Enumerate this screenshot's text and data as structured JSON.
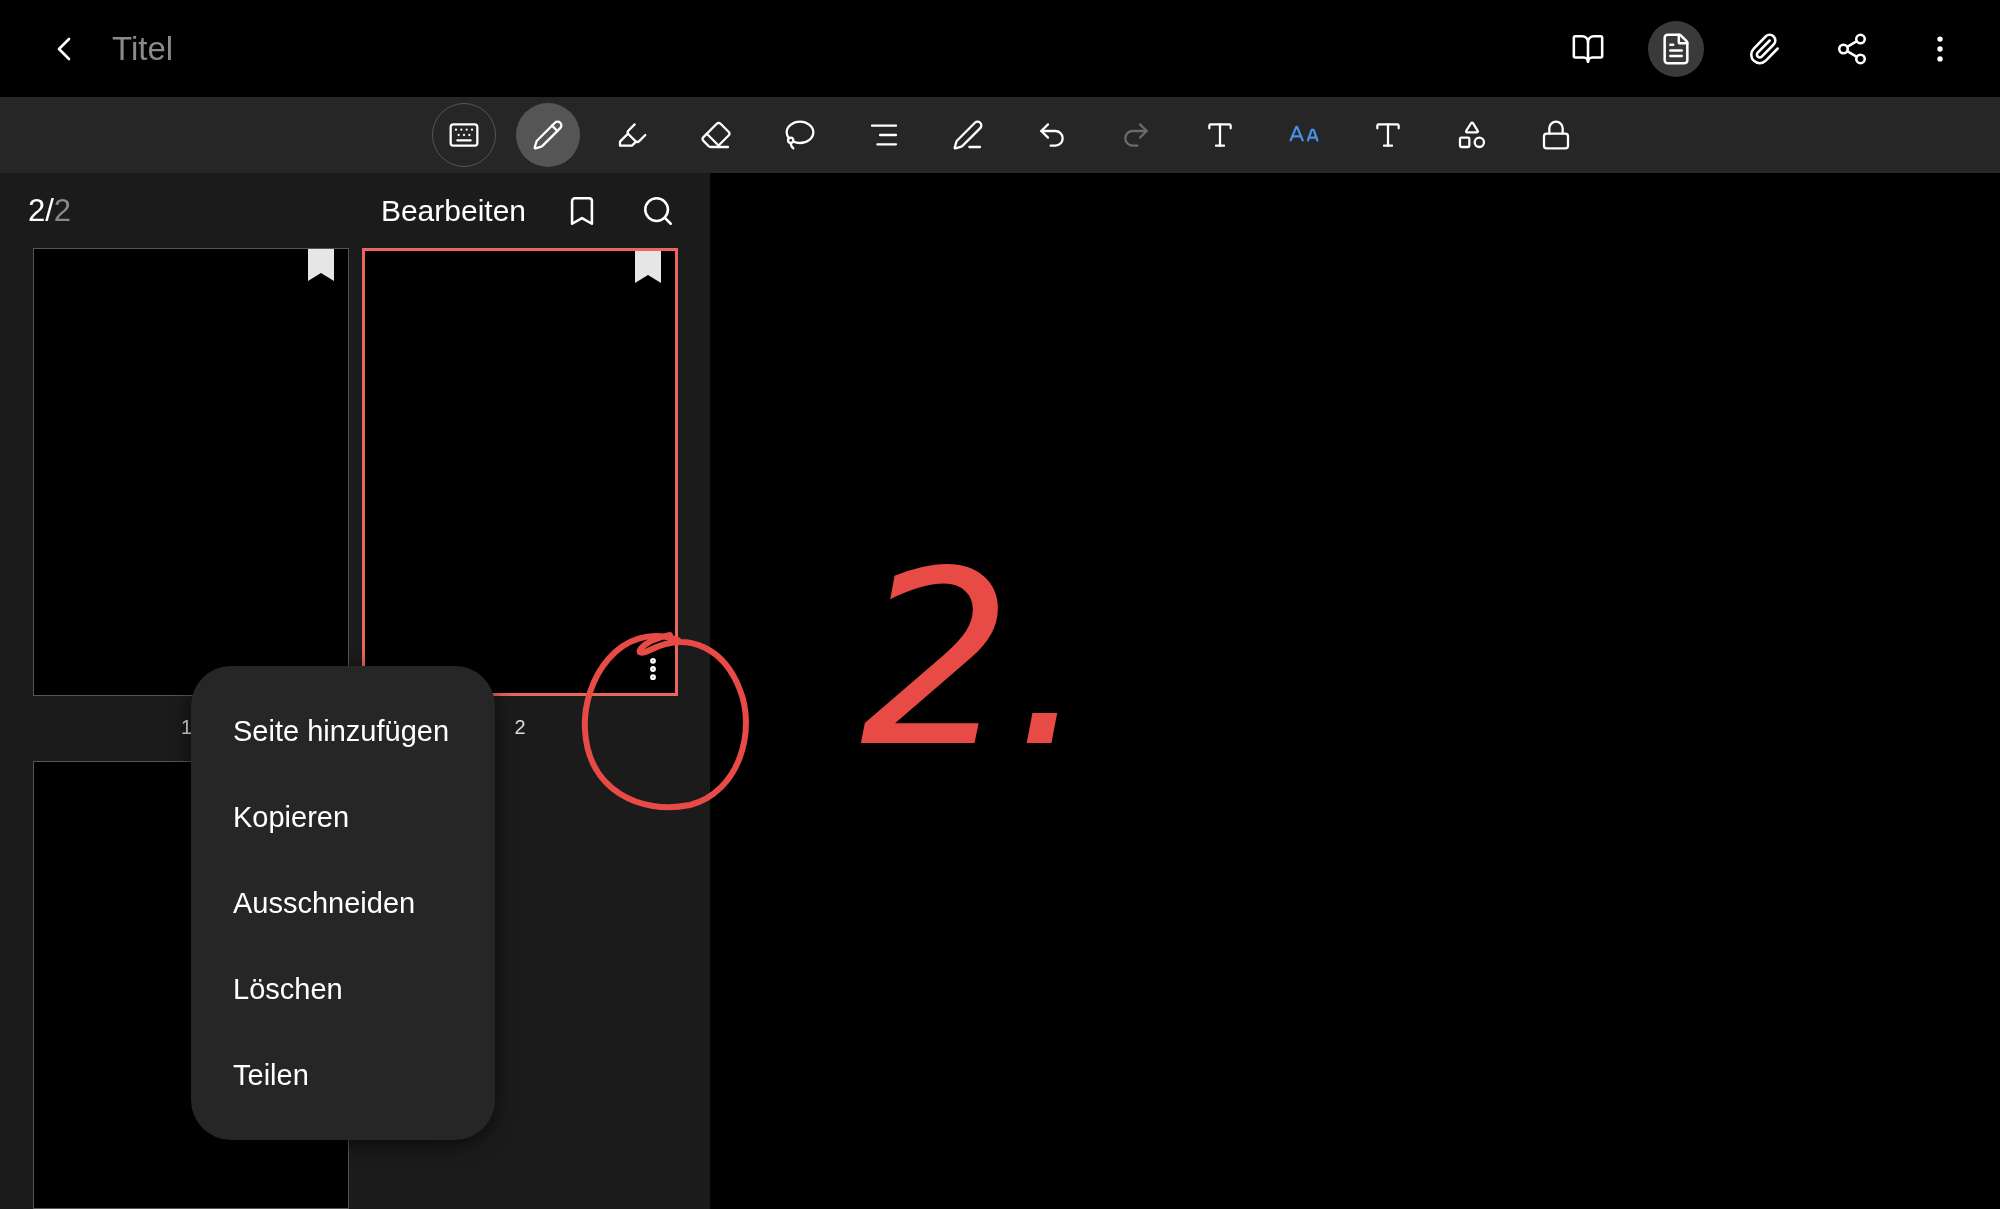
{
  "header": {
    "title": "Titel",
    "actions": [
      {
        "kind": "book",
        "selected": false
      },
      {
        "kind": "page-view",
        "selected": true
      },
      {
        "kind": "attach",
        "selected": false
      },
      {
        "kind": "share",
        "selected": false
      },
      {
        "kind": "more",
        "selected": false
      }
    ]
  },
  "toolbar": {
    "tools": [
      {
        "kind": "keyboard",
        "selected": false,
        "disabled": false
      },
      {
        "kind": "pen",
        "selected": true,
        "disabled": false
      },
      {
        "kind": "highlighter",
        "selected": false,
        "disabled": false
      },
      {
        "kind": "eraser",
        "selected": false,
        "disabled": false
      },
      {
        "kind": "lasso",
        "selected": false,
        "disabled": false
      },
      {
        "kind": "align",
        "selected": false,
        "disabled": false
      },
      {
        "kind": "pen-text",
        "selected": false,
        "disabled": false
      },
      {
        "kind": "undo",
        "selected": false,
        "disabled": false
      },
      {
        "kind": "redo",
        "selected": false,
        "disabled": true
      },
      {
        "kind": "handwriting",
        "selected": false,
        "disabled": false
      },
      {
        "kind": "text-style",
        "selected": false,
        "disabled": false
      },
      {
        "kind": "text-box",
        "selected": false,
        "disabled": false
      },
      {
        "kind": "shapes",
        "selected": false,
        "disabled": false
      },
      {
        "kind": "lock",
        "selected": false,
        "disabled": false
      }
    ]
  },
  "sidebar": {
    "page_counter": {
      "current": "2/",
      "total": "2"
    },
    "edit_label": "Bearbeiten",
    "pages": [
      {
        "label": "1",
        "selected": false,
        "bookmarked": true
      },
      {
        "label": "2",
        "selected": true,
        "bookmarked": true
      },
      {
        "selected": false,
        "bookmarked": false
      }
    ]
  },
  "context_menu": {
    "items": [
      "Seite hinzufügen",
      "Kopieren",
      "Ausschneiden",
      "Löschen",
      "Teilen"
    ]
  },
  "annotation": {
    "text": "2."
  }
}
